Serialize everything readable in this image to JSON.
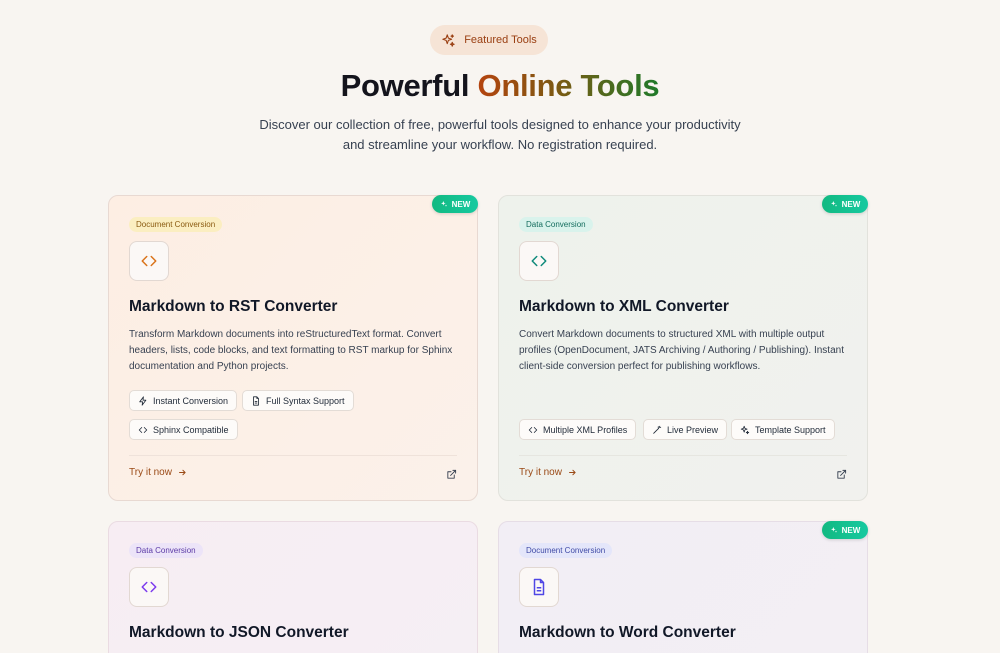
{
  "header": {
    "badge_label": "Featured Tools",
    "title_part1": "Powerful",
    "title_part2": "Online Tools",
    "subtitle_line1": "Discover our collection of free, powerful tools designed to enhance your productivity",
    "subtitle_line2": "and streamline your workflow. No registration required."
  },
  "colors": {
    "accent": "#9a4a16",
    "new_badge": "#12b981",
    "background": "#f8f5f1"
  },
  "cards": [
    {
      "new_label": "NEW",
      "category": "Document Conversion",
      "icon": "code-icon",
      "title": "Markdown to RST Converter",
      "description": "Transform Markdown documents into reStructuredText format. Convert headers, lists, code blocks, and text formatting to RST markup for Sphinx documentation and Python projects.",
      "features": [
        "Instant Conversion",
        "Full Syntax Support",
        "Sphinx Compatible"
      ],
      "cta": "Try it now"
    },
    {
      "new_label": "NEW",
      "category": "Data Conversion",
      "icon": "code-icon",
      "title": "Markdown to XML Converter",
      "description": "Convert Markdown documents to structured XML with multiple output profiles (OpenDocument, JATS Archiving / Authoring / Publishing). Instant client-side conversion perfect for publishing workflows.",
      "features": [
        "Multiple XML Profiles",
        "Live Preview",
        "Template Support"
      ],
      "cta": "Try it now"
    },
    {
      "category": "Data Conversion",
      "icon": "code-icon",
      "title": "Markdown to JSON Converter"
    },
    {
      "new_label": "NEW",
      "category": "Document Conversion",
      "icon": "document-icon",
      "title": "Markdown to Word Converter"
    }
  ]
}
